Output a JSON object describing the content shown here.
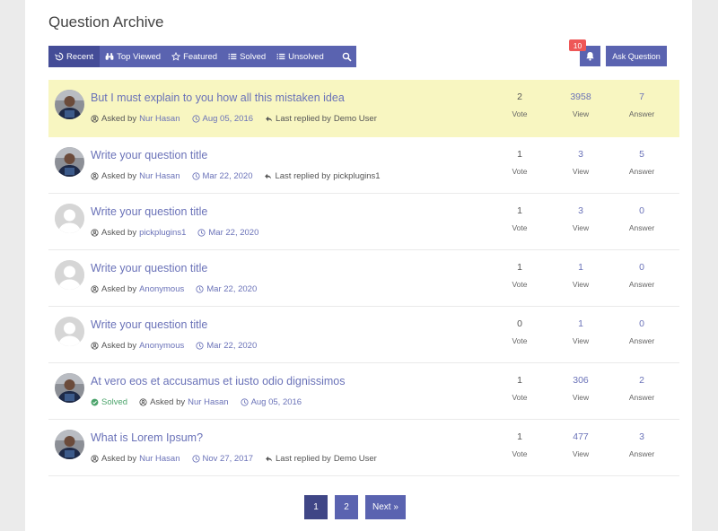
{
  "page": {
    "title": "Question Archive"
  },
  "filters": [
    {
      "label": "Recent",
      "icon": "history-icon",
      "active": true
    },
    {
      "label": "Top Viewed",
      "icon": "binoculars-icon",
      "active": false
    },
    {
      "label": "Featured",
      "icon": "star-icon",
      "active": false
    },
    {
      "label": "Solved",
      "icon": "list-icon",
      "active": false
    },
    {
      "label": "Unsolved",
      "icon": "list-icon",
      "active": false
    }
  ],
  "notifications": {
    "count": "10"
  },
  "ask_button": {
    "label": "Ask Question"
  },
  "labels": {
    "asked_by": "Asked by",
    "last_replied_by": "Last replied by",
    "vote": "Vote",
    "view": "View",
    "answer": "Answer",
    "solved": "Solved"
  },
  "questions": [
    {
      "title": "But I must explain to you how all this mistaken idea",
      "author": "Nur Hasan",
      "date": "Aug 05, 2016",
      "last_replied": "Demo User",
      "votes": "2",
      "views": "3958",
      "answers": "7",
      "avatar": "photo",
      "sticky": true
    },
    {
      "title": "Write your question title",
      "author": "Nur Hasan",
      "date": "Mar 22, 2020",
      "last_replied": "pickplugins1",
      "votes": "1",
      "views": "3",
      "answers": "5",
      "avatar": "photo"
    },
    {
      "title": "Write your question title",
      "author": "pickplugins1",
      "date": "Mar 22, 2020",
      "votes": "1",
      "views": "3",
      "answers": "0",
      "avatar": "default"
    },
    {
      "title": "Write your question title",
      "author": "Anonymous",
      "date": "Mar 22, 2020",
      "votes": "1",
      "views": "1",
      "answers": "0",
      "avatar": "default"
    },
    {
      "title": "Write your question title",
      "author": "Anonymous",
      "date": "Mar 22, 2020",
      "votes": "0",
      "views": "1",
      "answers": "0",
      "avatar": "default"
    },
    {
      "title": "At vero eos et accusamus et iusto odio dignissimos",
      "solved": true,
      "author": "Nur Hasan",
      "date": "Aug 05, 2016",
      "votes": "1",
      "views": "306",
      "answers": "2",
      "avatar": "photo"
    },
    {
      "title": "What is Lorem Ipsum?",
      "author": "Nur Hasan",
      "date": "Nov 27, 2017",
      "last_replied": "Demo User",
      "votes": "1",
      "views": "477",
      "answers": "3",
      "avatar": "photo"
    }
  ],
  "pagination": {
    "pages": [
      "1",
      "2"
    ],
    "current": "1",
    "next_label": "Next »"
  },
  "colors": {
    "accent": "#5a63b0",
    "active": "#444c97",
    "sticky_bg": "#f8f6c1",
    "link": "#6a72b8",
    "badge": "#ee5757",
    "solved": "#4aa36a"
  }
}
